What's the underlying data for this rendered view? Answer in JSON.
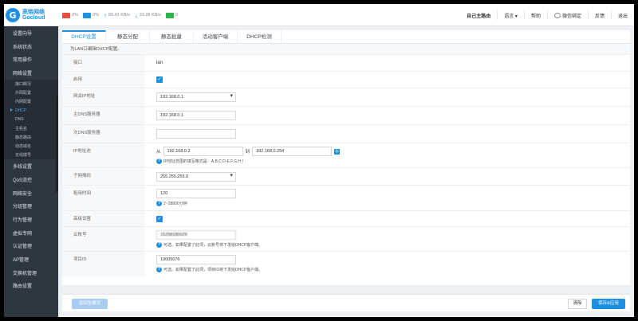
{
  "brand": {
    "name_cn": "高恪网络",
    "name_en": "Gocloud"
  },
  "status": {
    "cpu": "0%",
    "mem": "0%",
    "upload": "80.43 KB/s",
    "download": "33.06 KB/s",
    "users": "9"
  },
  "topnav": {
    "items": [
      "自己主路由",
      "语言 ▾",
      "帮助",
      "微信绑定",
      "反馈",
      "退出"
    ]
  },
  "sidebar": {
    "items_top": [
      "设置向导",
      "系统状态",
      "常用操作",
      "网络设置"
    ],
    "sub_items": [
      "接口概况",
      "外网配置",
      "内网配置",
      "DHCP",
      "DNS",
      "主机名",
      "静态路由",
      "动态域名",
      "无线拨号"
    ],
    "active_sub": "DHCP",
    "items_bottom": [
      "多线设置",
      "QoS流控",
      "网络安全",
      "分组管理",
      "行为管理",
      "虚拟专网",
      "认证管理",
      "AP管理",
      "交换机管理",
      "路由设置"
    ]
  },
  "tabs": [
    "DHCP设置",
    "静态分配",
    "静态批量",
    "活动客户端",
    "DHCP检测"
  ],
  "active_tab": "DHCP设置",
  "description": "为LAN口编辑DHCP配置。",
  "form": {
    "interface": {
      "label": "接口",
      "value": "lan"
    },
    "enable": {
      "label": "启用",
      "checked": true
    },
    "gateway": {
      "label": "网关IP地址",
      "value": "192.168.0.1"
    },
    "dns1": {
      "label": "主DNS服务器",
      "value": "192.168.0.1"
    },
    "dns2": {
      "label": "次DNS服务器",
      "value": ""
    },
    "ip_range": {
      "label": "IP地址池",
      "from_label": "从",
      "from": "192.168.0.2",
      "to_label": "到",
      "to": "192.168.0.254",
      "hint": "IP地址范围的填写格式是：A.B.C.D-E.F.G.H ！"
    },
    "netmask": {
      "label": "子网掩码",
      "value": "255.255.255.0"
    },
    "lease": {
      "label": "租用时间",
      "value": "120",
      "hint": "2~28800分钟"
    },
    "advanced": {
      "label": "高级设置",
      "checked": true
    },
    "cloud_account": {
      "label": "云账号",
      "value": "15298180029",
      "hint": "可选。如果配置了此项，云账号将下发给DHCP客户端。"
    },
    "project_id": {
      "label": "项目ID",
      "value": "10005076",
      "hint": "可选。如果配置了此项，项目ID将下发给DHCP客户端。"
    }
  },
  "buttons": {
    "left": "返回至概况",
    "clear": "清除",
    "save": "保存&应用"
  },
  "colors": {
    "accent": "#1f8fe1",
    "sidebar": "#2e3640"
  }
}
